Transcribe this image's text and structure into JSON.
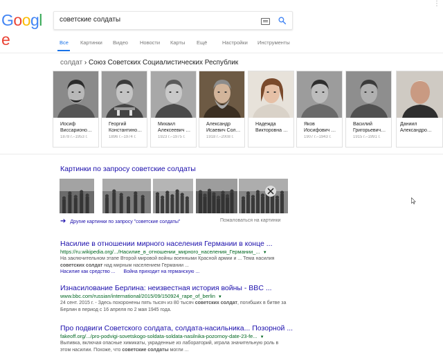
{
  "header": {
    "logo_letters": [
      {
        "ch": "G",
        "color": "#4285F4"
      },
      {
        "ch": "o",
        "color": "#EA4335"
      },
      {
        "ch": "o",
        "color": "#FBBC05"
      },
      {
        "ch": "g",
        "color": "#4285F4"
      },
      {
        "ch": "l",
        "color": "#34A853"
      },
      {
        "ch": "e",
        "color": "#EA4335"
      }
    ],
    "query": "советские солдаты",
    "search_icon": "search-icon",
    "keyboard_icon": "keyboard-icon"
  },
  "tabs": [
    "Все",
    "Картинки",
    "Видео",
    "Новости",
    "Карты",
    "Ещё",
    "Настройки",
    "Инструменты"
  ],
  "tabs_active": 0,
  "carousel": {
    "crumb_parent": "солдат",
    "crumb_sep": " › ",
    "crumb_title": "Союз Советских Социалистических Республик",
    "cards": [
      {
        "name1": "Иосиф",
        "name2": "Виссарионо…",
        "years": "1878 г.–1953 г."
      },
      {
        "name1": "Георгий",
        "name2": "Константино…",
        "years": "1896 г.–1974 г."
      },
      {
        "name1": "Михаил",
        "name2": "Алексеевич …",
        "years": "1923 г.–1975 г."
      },
      {
        "name1": "Александр",
        "name2": "Исаевич Сол…",
        "years": "1918 г.–2008 г."
      },
      {
        "name1": "Надежда",
        "name2": "Викторовна …",
        "years": ""
      },
      {
        "name1": "Яков",
        "name2": "Иосифович …",
        "years": "1907 г.–1943 г."
      },
      {
        "name1": "Василий",
        "name2": "Григорьевич…",
        "years": "1915 г.–1991 г."
      }
    ],
    "right_card": {
      "name1": "Даниил",
      "name2": "Александро…"
    }
  },
  "images_section": {
    "title": "Картинки по запросу советские солдаты",
    "more_label": "Другие картинки по запросу \"советские солдаты\"",
    "report_label": "Пожаловаться на картинки"
  },
  "results": [
    {
      "title": "Насилие в отношении мирного населения Германии в конце ...",
      "url": "https://ru.wikipedia.org/.../Насилие_в_отношении_мирного_населения_Германии_...",
      "snippet_parts": [
        {
          "t": "На заключительном этапе Второй мировой войны военными Красной армии и ... Тема насилия ",
          "b": false
        },
        {
          "t": "советских солдат",
          "b": true
        },
        {
          "t": " над мирным населением Германии ...",
          "b": false
        }
      ],
      "sitelinks": [
        "Насилие как средство ...",
        "Война приходит на германскую ..."
      ]
    },
    {
      "title": "Изнасилование Берлина: неизвестная история войны - BBC ...",
      "url": "www.bbc.com/russian/international/2015/09/150924_rape_of_berlin",
      "snippet_parts": [
        {
          "t": "24 сент. 2015 г. - Здесь похоронены пять тысяч из 80 тысяч ",
          "b": false
        },
        {
          "t": "советских солдат",
          "b": true
        },
        {
          "t": ", погибших в битве за Берлин в период с 16 апреля по 2 мая 1945 года.",
          "b": false
        }
      ],
      "sitelinks": []
    },
    {
      "title": "Про подвиги Советского солдата, солдата-насильника... Позорной ...",
      "url": "fakeoff.org/.../pro-podvigi-sovetskogo-soldata-soldata-nasilnika-pozornoy-date-23-fe...",
      "snippet_parts": [
        {
          "t": "Выпивка, включая опасные химикаты, украденные из лабораторий, играла значительную роль в этом насилии. Похоже, что ",
          "b": false
        },
        {
          "t": "советские солдаты",
          "b": true
        },
        {
          "t": " могли ...",
          "b": false
        }
      ],
      "sitelinks": []
    }
  ],
  "colors": {
    "link": "#1a0dab",
    "url": "#006621",
    "accent": "#1a73e8",
    "snippet": "#545454"
  }
}
